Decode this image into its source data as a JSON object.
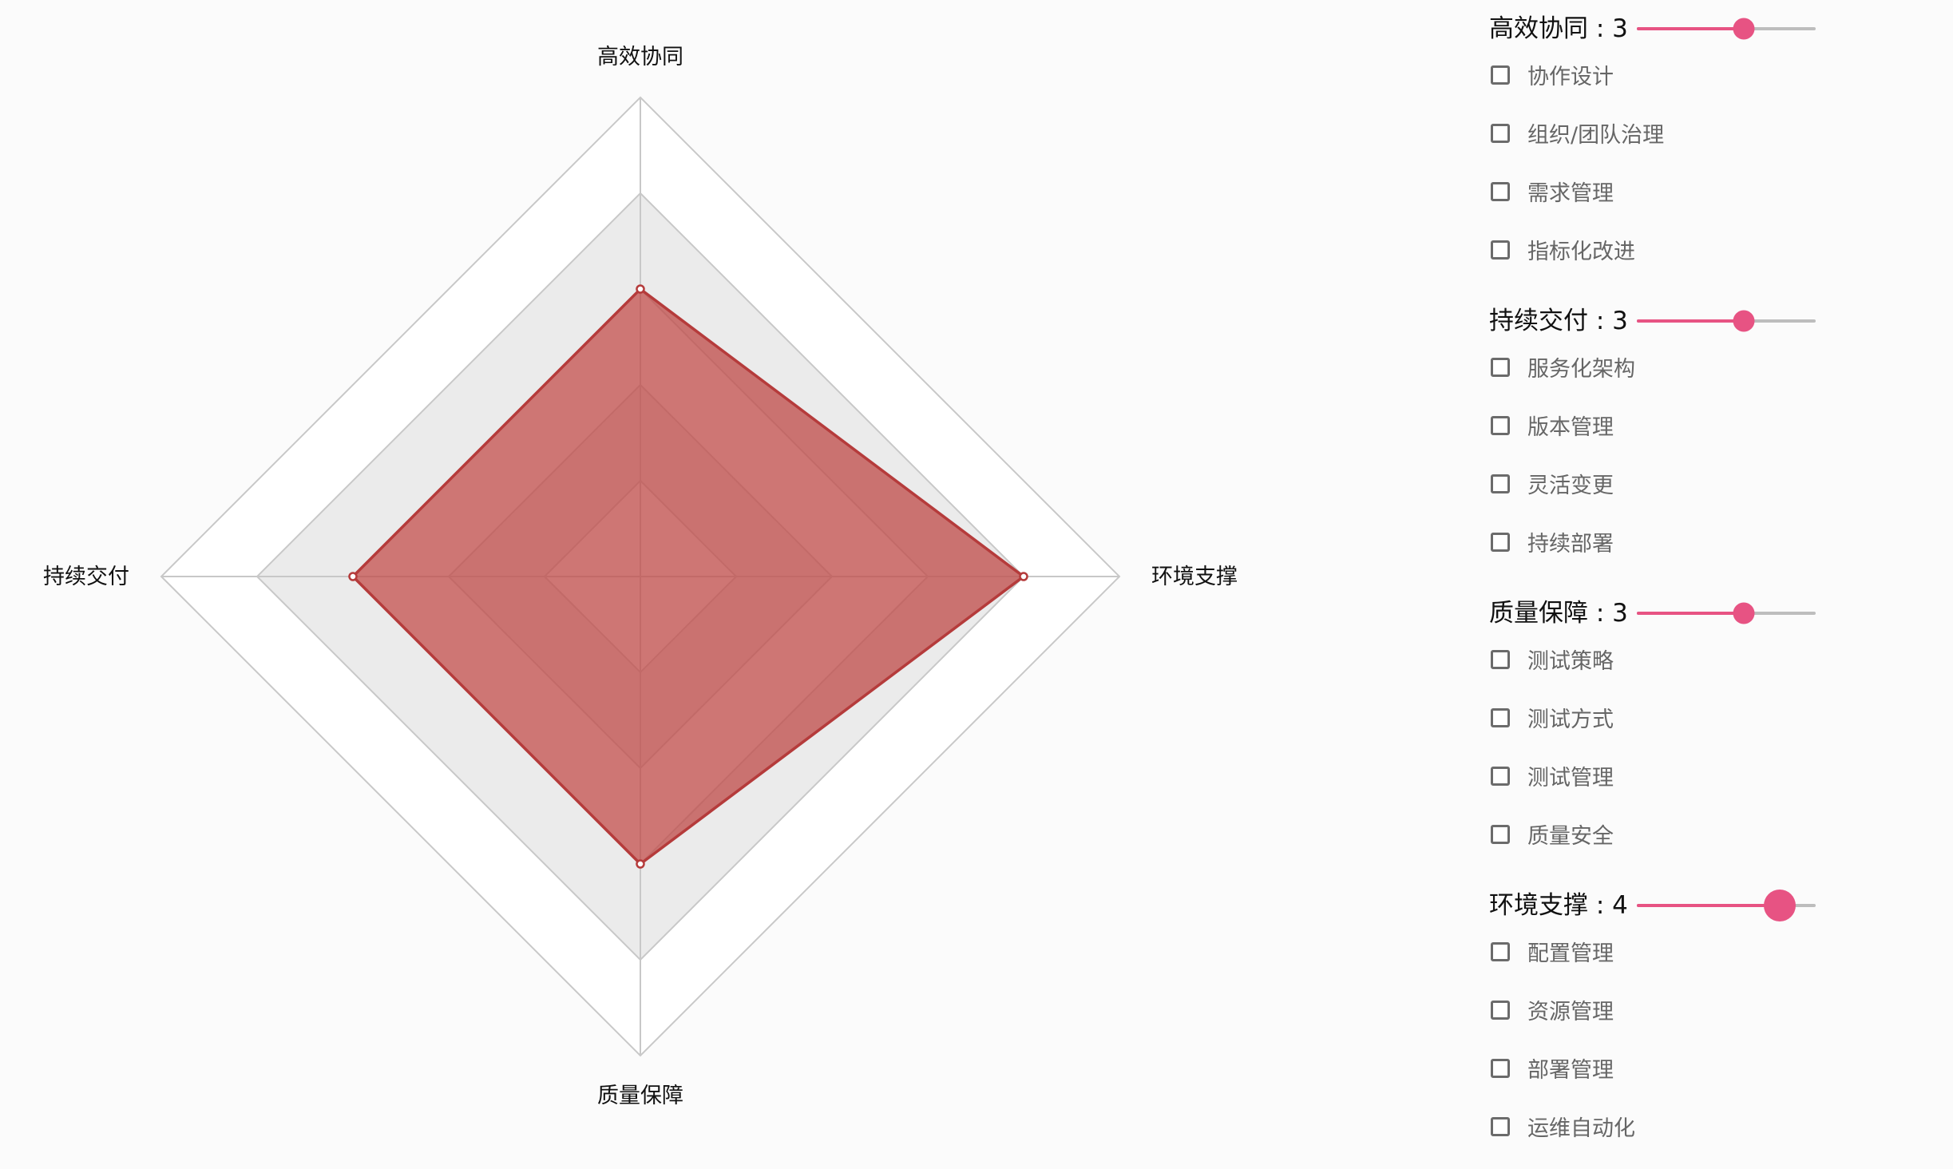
{
  "colors": {
    "accent": "#e75383",
    "radar_fill": "#c0504d",
    "radar_stroke": "#b53b3b",
    "grid_band": "#ebebeb",
    "grid_line": "#c8c8c8"
  },
  "chart_data": {
    "type": "radar",
    "max": 5,
    "levels": 5,
    "axes": [
      "高效协同",
      "环境支撑",
      "质量保障",
      "持续交付"
    ],
    "series": [
      {
        "values": [
          3,
          4,
          3,
          3
        ]
      }
    ]
  },
  "panel": {
    "sections": [
      {
        "title": "高效协同",
        "value": 3,
        "max": 5,
        "items": [
          "协作设计",
          "组织/团队治理",
          "需求管理",
          "指标化改进"
        ]
      },
      {
        "title": "持续交付",
        "value": 3,
        "max": 5,
        "items": [
          "服务化架构",
          "版本管理",
          "灵活变更",
          "持续部署"
        ]
      },
      {
        "title": "质量保障",
        "value": 3,
        "max": 5,
        "items": [
          "测试策略",
          "测试方式",
          "测试管理",
          "质量安全"
        ]
      },
      {
        "title": "环境支撑",
        "value": 4,
        "max": 5,
        "active": true,
        "items": [
          "配置管理",
          "资源管理",
          "部署管理",
          "运维自动化"
        ]
      }
    ]
  }
}
